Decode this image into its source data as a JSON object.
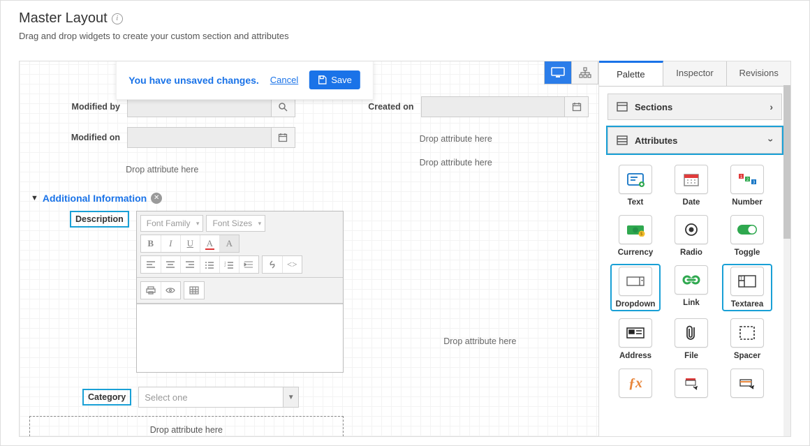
{
  "header": {
    "title": "Master Layout",
    "subtitle": "Drag and drop widgets to create your custom section and attributes"
  },
  "banner": {
    "message": "You have unsaved changes.",
    "cancel": "Cancel",
    "save": "Save"
  },
  "fields": {
    "modified_by_label": "Modified by",
    "modified_on_label": "Modified on",
    "created_on_label": "Created on",
    "drop_hint": "Drop attribute here"
  },
  "section": {
    "name": "Additional Information",
    "description_label": "Description",
    "category_label": "Category",
    "category_placeholder": "Select one"
  },
  "rte": {
    "font_family": "Font Family",
    "font_sizes": "Font Sizes"
  },
  "panel": {
    "tabs": {
      "palette": "Palette",
      "inspector": "Inspector",
      "revisions": "Revisions"
    },
    "sections": "Sections",
    "attributes": "Attributes",
    "attrs": {
      "text": "Text",
      "date": "Date",
      "number": "Number",
      "currency": "Currency",
      "radio": "Radio",
      "toggle": "Toggle",
      "dropdown": "Dropdown",
      "link": "Link",
      "textarea": "Textarea",
      "address": "Address",
      "file": "File",
      "spacer": "Spacer"
    }
  }
}
